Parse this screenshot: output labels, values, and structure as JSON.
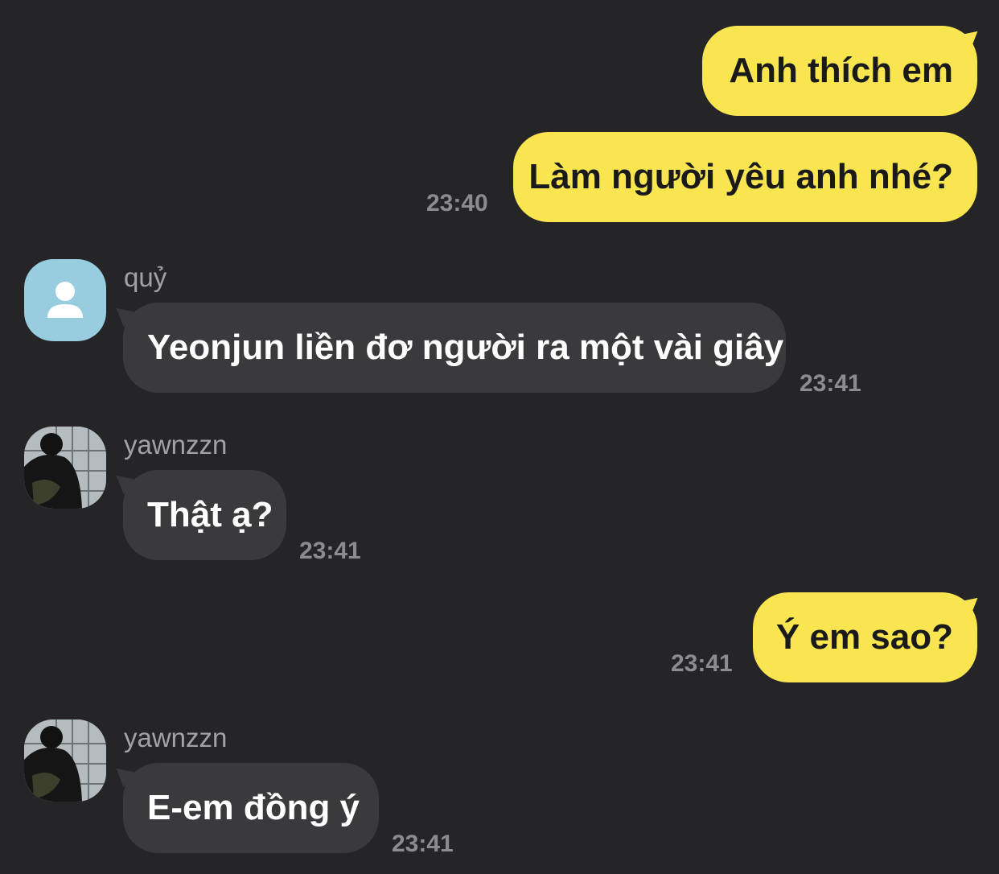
{
  "colors": {
    "background": "#252527",
    "outgoing_bubble": "#f9e54f",
    "incoming_bubble": "#3a3a3d",
    "timestamp": "#8c8c90",
    "sender_name": "#a2a2a6",
    "default_avatar": "#98cde0"
  },
  "messages": [
    {
      "direction": "outgoing",
      "text": "Anh thích em"
    },
    {
      "direction": "outgoing",
      "text": "Làm người yêu anh nhé?",
      "time": "23:40"
    },
    {
      "direction": "incoming",
      "sender": "quỷ",
      "avatar_icon": "default-person-icon",
      "text": "Yeonjun liền đơ người ra một vài giây",
      "time": "23:41"
    },
    {
      "direction": "incoming",
      "sender": "yawnzzn",
      "avatar_icon": "profile-photo",
      "text": "Thật ạ?",
      "time": "23:41"
    },
    {
      "direction": "outgoing",
      "text": "Ý em sao?",
      "time": "23:41"
    },
    {
      "direction": "incoming",
      "sender": "yawnzzn",
      "avatar_icon": "profile-photo",
      "text": "E-em đồng ý",
      "time": "23:41"
    }
  ]
}
